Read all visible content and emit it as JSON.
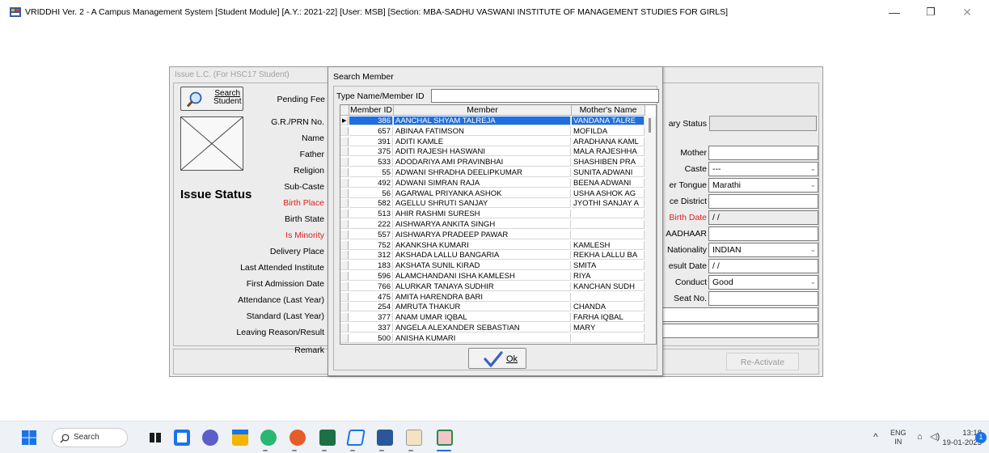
{
  "window": {
    "title": "VRIDDHI Ver. 2 - A Campus Management System [Student Module] [A.Y.: 2021-22] [User: MSB] [Section: MBA-SADHU VASWANI INSTITUTE OF MANAGEMENT STUDIES FOR GIRLS]",
    "minimize": "—",
    "maximize": "❐",
    "close": "✕"
  },
  "lc_form": {
    "title": "Issue L.C. (For HSC17 Student)",
    "search_button": "Search Student",
    "search_button_line1": "Search",
    "search_button_line2": "Student",
    "pending_fee": "Pending Fee",
    "issue_status": "Issue Status",
    "left_labels": [
      {
        "label": "G.R./PRN No.",
        "red": false
      },
      {
        "label": "Name",
        "red": false
      },
      {
        "label": "Father",
        "red": false
      },
      {
        "label": "Religion",
        "red": false
      },
      {
        "label": "Sub-Caste",
        "red": false
      },
      {
        "label": "Birth Place",
        "red": true
      },
      {
        "label": "Birth State",
        "red": false
      },
      {
        "label": "Is Minority",
        "red": true
      },
      {
        "label": "Delivery Place",
        "red": false
      },
      {
        "label": "Last Attended Institute",
        "red": false
      },
      {
        "label": "First Admission Date",
        "red": false
      },
      {
        "label": "Attendance (Last Year)",
        "red": false
      },
      {
        "label": "Standard (Last Year)",
        "red": false
      },
      {
        "label": "Leaving Reason/Result",
        "red": false
      },
      {
        "label": "Remark",
        "red": false
      }
    ],
    "right_status_label": "ary Status",
    "right_fields": {
      "mother": {
        "label": "Mother",
        "value": ""
      },
      "caste": {
        "label": "Caste",
        "value": "---"
      },
      "mother_tongue": {
        "label": "er Tongue",
        "value": "Marathi"
      },
      "district": {
        "label": "ce District",
        "value": ""
      },
      "birth_date": {
        "label": "Birth Date",
        "value": "/ /"
      },
      "aadhaar": {
        "label": "AADHAAR",
        "value": ""
      },
      "nationality": {
        "label": "Nationality",
        "value": "INDIAN"
      },
      "result_date": {
        "label": "esult Date",
        "value": "/ /"
      },
      "conduct": {
        "label": "Conduct",
        "value": "Good"
      },
      "seat_no": {
        "label": "Seat No.",
        "value": ""
      }
    },
    "reactivate_button": "Re-Activate"
  },
  "search_member": {
    "title": "Search Member",
    "type_label": "Type Name/Member ID",
    "input_value": "",
    "columns": [
      "Member ID",
      "Member",
      "Mother's Name"
    ],
    "rows": [
      {
        "id": "386",
        "member": "AANCHAL SHYAM TALREJA",
        "mother": "VANDANA TALRE"
      },
      {
        "id": "657",
        "member": "ABINAA FATIMSON",
        "mother": "MOFILDA"
      },
      {
        "id": "391",
        "member": "ADITI KAMLE",
        "mother": "ARADHANA KAML"
      },
      {
        "id": "375",
        "member": "ADITI RAJESH HASWANI",
        "mother": "MALA RAJESHHA"
      },
      {
        "id": "533",
        "member": "ADODARIYA AMI PRAVINBHAI",
        "mother": "SHASHIBEN PRA"
      },
      {
        "id": "55",
        "member": "ADWANI SHRADHA DEELIPKUMAR",
        "mother": "SUNITA ADWANI"
      },
      {
        "id": "492",
        "member": "ADWANI SIMRAN RAJA",
        "mother": "BEENA ADWANI"
      },
      {
        "id": "56",
        "member": "AGARWAL PRIYANKA ASHOK",
        "mother": "USHA ASHOK AG"
      },
      {
        "id": "582",
        "member": "AGELLU SHRUTI SANJAY",
        "mother": "JYOTHI SANJAY A"
      },
      {
        "id": "513",
        "member": "AHIR RASHMI SURESH",
        "mother": ""
      },
      {
        "id": "222",
        "member": "AISHWARYA ANKITA SINGH",
        "mother": ""
      },
      {
        "id": "557",
        "member": "AISHWARYA PRADEEP PAWAR",
        "mother": ""
      },
      {
        "id": "752",
        "member": "AKANKSHA KUMARI",
        "mother": "KAMLESH"
      },
      {
        "id": "312",
        "member": "AKSHADA LALLU BANGARIA",
        "mother": "REKHA LALLU BA"
      },
      {
        "id": "183",
        "member": "AKSHATA SUNIL KIRAD",
        "mother": "SMITA"
      },
      {
        "id": "596",
        "member": "ALAMCHANDANI ISHA KAMLESH",
        "mother": "RIYA"
      },
      {
        "id": "766",
        "member": "ALURKAR TANAYA SUDHIR",
        "mother": "KANCHAN SUDH"
      },
      {
        "id": "475",
        "member": "AMITA HARENDRA BARI",
        "mother": ""
      },
      {
        "id": "254",
        "member": "AMRUTA THAKUR",
        "mother": "CHANDA"
      },
      {
        "id": "377",
        "member": "ANAM UMAR IQBAL",
        "mother": "FARHA IQBAL"
      },
      {
        "id": "337",
        "member": "ANGELA ALEXANDER SEBASTIAN",
        "mother": "MARY"
      },
      {
        "id": "500",
        "member": "ANISHA KUMARI",
        "mother": ""
      }
    ],
    "ok_button": "Ok"
  },
  "taskbar": {
    "search_label": "Search",
    "tray_chevron": "^",
    "lang_line1": "ENG",
    "lang_line2": "IN",
    "time": "13:18",
    "date": "19-01-2023",
    "badge": "1"
  }
}
